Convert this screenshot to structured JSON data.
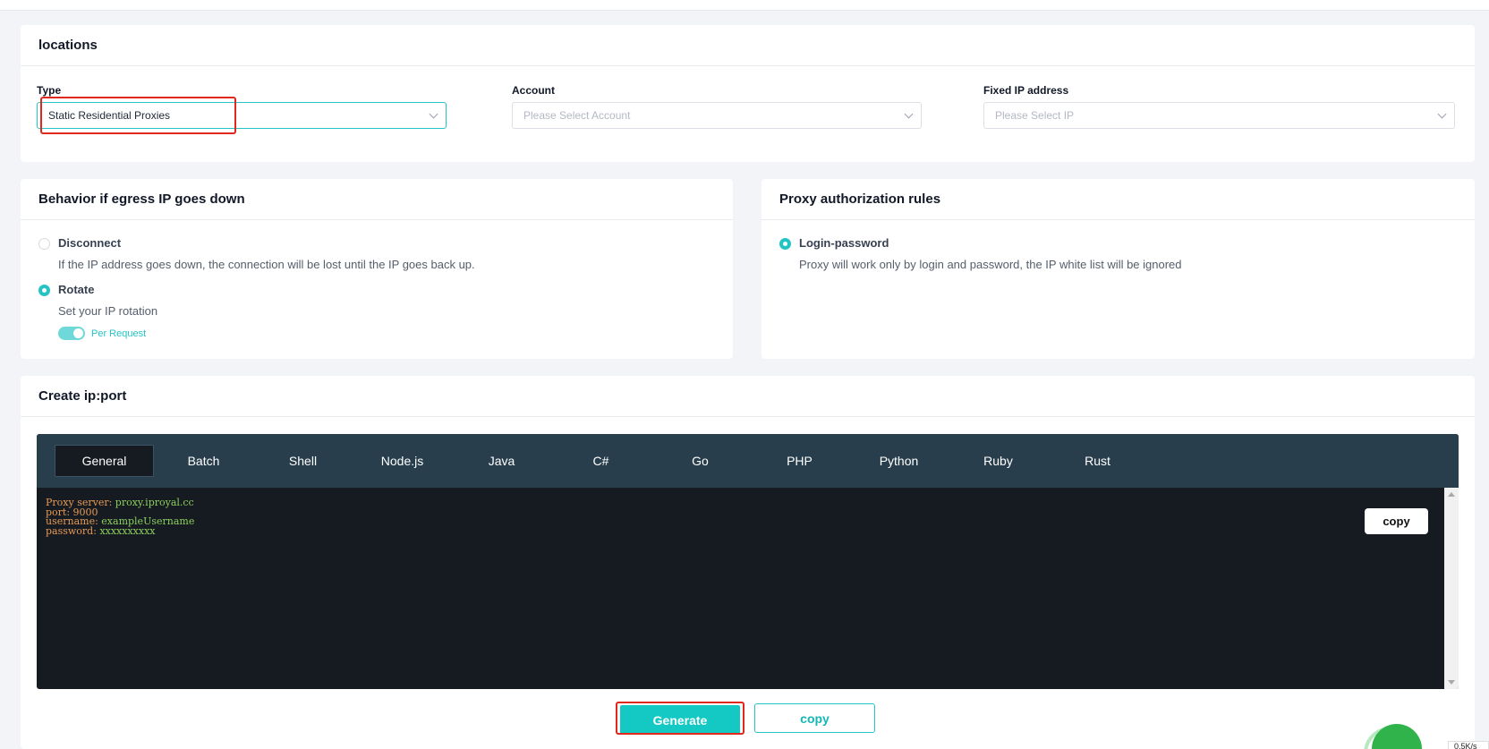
{
  "locations": {
    "title": "locations",
    "type": {
      "label": "Type",
      "value": "Static Residential Proxies"
    },
    "account": {
      "label": "Account",
      "placeholder": "Please Select Account"
    },
    "fixed_ip": {
      "label": "Fixed IP address",
      "placeholder": "Please Select IP"
    }
  },
  "behavior": {
    "title": "Behavior if egress IP goes down",
    "options": [
      {
        "title": "Disconnect",
        "desc": "If the IP address goes down, the connection will be lost until the IP goes back up.",
        "selected": false
      },
      {
        "title": "Rotate",
        "desc": "Set your IP rotation",
        "selected": true
      }
    ],
    "toggle": {
      "label": "Per Request",
      "on": true
    }
  },
  "rules": {
    "title": "Proxy authorization rules",
    "option": {
      "title": "Login-password",
      "desc": "Proxy will work only by login and password, the IP white list will be ignored",
      "selected": true
    }
  },
  "create": {
    "title": "Create ip:port",
    "tabs": [
      "General",
      "Batch",
      "Shell",
      "Node.js",
      "Java",
      "C#",
      "Go",
      "PHP",
      "Python",
      "Ruby",
      "Rust"
    ],
    "active_tab": "General",
    "code": [
      {
        "key": "Proxy server: ",
        "value": "proxy.iproyal.cc"
      },
      {
        "key": "port: ",
        "value": "9000"
      },
      {
        "key": "username: ",
        "value": "exampleUsername"
      },
      {
        "key": "password: ",
        "value": "xxxxxxxxxx"
      }
    ],
    "copy_inner_label": "copy",
    "generate_label": "Generate",
    "copy_label": "copy"
  },
  "status": {
    "net_speed": "0.5K/s"
  },
  "colors": {
    "accent": "#14c9c4",
    "highlight": "#e0281d",
    "code_bg": "#161a21",
    "tabs_bg": "#283e4d"
  }
}
